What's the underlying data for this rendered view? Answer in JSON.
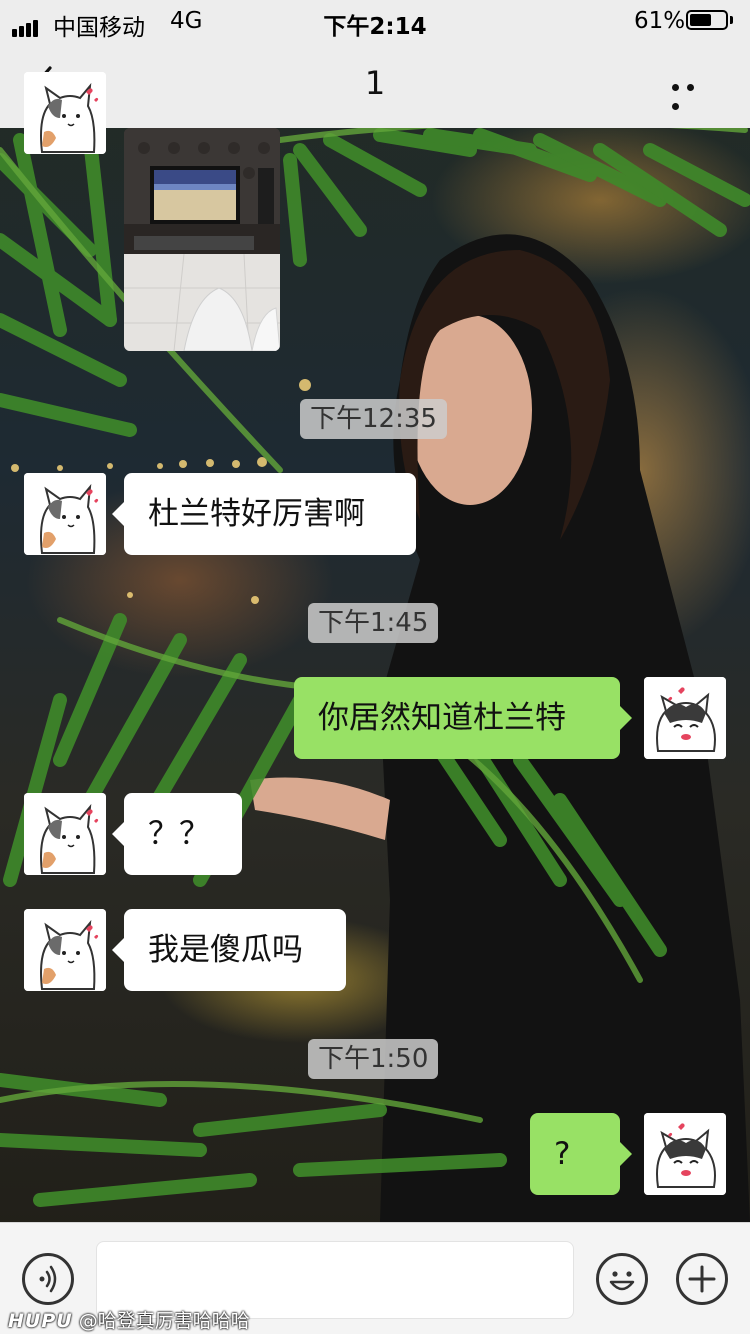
{
  "status_bar": {
    "carrier": "中国移动",
    "network": "4G",
    "time": "下午2:14",
    "battery_text": "61%",
    "battery_level": 0.61
  },
  "nav": {
    "back_icon": "chevron-left-icon",
    "title": "1",
    "more_icon": "more-dots-icon"
  },
  "messages": [
    {
      "kind": "image",
      "side": "left"
    },
    {
      "kind": "time",
      "text": "下午12:35"
    },
    {
      "kind": "text",
      "side": "left",
      "text": "杜兰特好厉害啊"
    },
    {
      "kind": "time",
      "text": "下午1:45"
    },
    {
      "kind": "text",
      "side": "right",
      "text": "你居然知道杜兰特"
    },
    {
      "kind": "text",
      "side": "left",
      "text": "？？"
    },
    {
      "kind": "text",
      "side": "left",
      "text": "我是傻瓜吗"
    },
    {
      "kind": "time",
      "text": "下午1:50"
    },
    {
      "kind": "text",
      "side": "right",
      "text": "?"
    }
  ],
  "input_bar": {
    "voice_icon": "voice-icon",
    "input_value": "",
    "emoji_icon": "emoji-icon",
    "plus_icon": "plus-icon"
  },
  "watermark": {
    "logo": "HUPU",
    "text": "@哈登真厉害哈哈哈"
  },
  "colors": {
    "bar_bg": "#ededed",
    "bubble_out": "#98e165",
    "bubble_in": "#ffffff",
    "time_label_bg": "#cdcdcd"
  }
}
